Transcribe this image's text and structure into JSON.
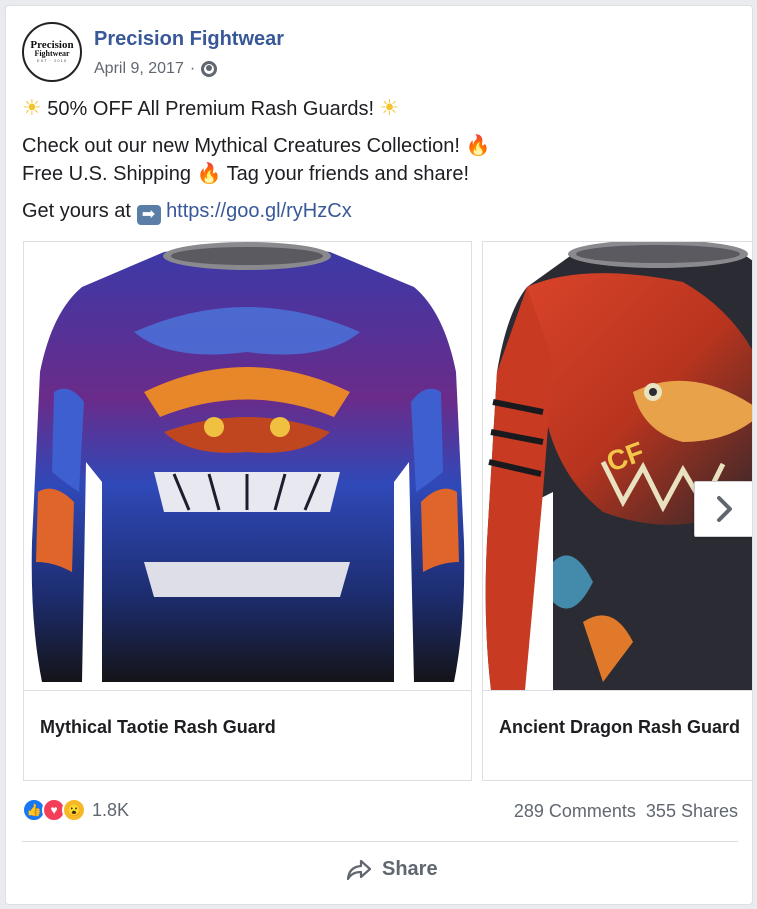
{
  "post": {
    "page_name": "Precision Fightwear",
    "avatar_text": [
      "Precision",
      "Fightwear",
      "EST · 2015"
    ],
    "date": "April 9, 2017",
    "separator": "·",
    "privacy_icon": "globe-icon",
    "lines": {
      "promo": "50% OFF All Premium Rash Guards!",
      "collection": "Check out our new Mythical Creatures Collection!",
      "shipping": "Free U.S. Shipping",
      "tag": "Tag your friends and share!",
      "get_yours": "Get yours at",
      "link": "https://goo.gl/ryHzCx"
    }
  },
  "carousel": {
    "items": [
      {
        "title": "Mythical Taotie Rash Guard",
        "image": "taotie-rash-guard-shirt"
      },
      {
        "title": "Ancient Dragon Rash Guard",
        "image": "dragon-rash-guard-shirt"
      }
    ],
    "next_icon": "chevron-right-icon"
  },
  "engagement": {
    "reactions": [
      "like",
      "love",
      "wow"
    ],
    "reaction_count": "1.8K",
    "comments": "289 Comments",
    "shares": "355 Shares"
  },
  "actions": {
    "share_label": "Share"
  },
  "colors": {
    "link": "#385898",
    "meta": "#606770",
    "like": "#1877f2",
    "love": "#f33e58",
    "wow": "#f7b928"
  }
}
